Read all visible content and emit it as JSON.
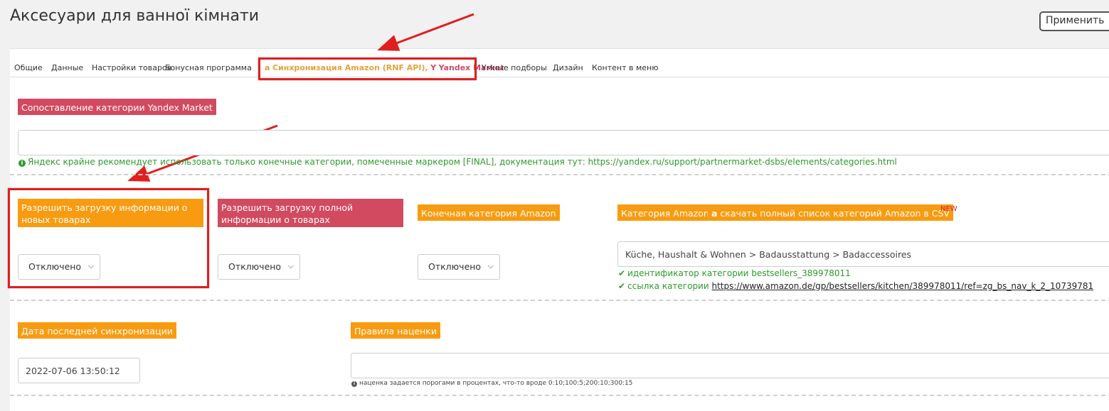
{
  "header": {
    "title": "Аксесуари для ванної кімнати",
    "apply_label": "Применить"
  },
  "tabs": [
    {
      "label": "Общие"
    },
    {
      "label": "Данные"
    },
    {
      "label": "Настройки товаров"
    },
    {
      "label": "Бонусная программа"
    },
    {
      "label_amazon": "Синхронизация Amazon (RNF API),",
      "label_yandex": "Yandex Market",
      "active": true
    },
    {
      "label": "Умные подборы"
    },
    {
      "label": "Дизайн"
    },
    {
      "label": "Контент в меню"
    }
  ],
  "yandex_section": {
    "label": "Сопоставление категории Yandex Market",
    "input_value": "",
    "help": "Яндекс крайне рекомендует использовать только конечные категории, помеченные маркером [FINAL], документация тут: https://yandex.ru/support/partnermarket-dsbs/elements/categories.html"
  },
  "amazon_section": {
    "new_items_label": "Разрешить загрузку информации о новых товарах",
    "new_items_value": "Отключено",
    "full_info_label": "Разрешить загрузку полной информации о товарах",
    "full_info_value": "Отключено",
    "final_category_label": "Конечная категория Amazon",
    "final_category_value": "Отключено",
    "category_label": "Категория Amazon",
    "download_label": "скачать полный список категорий Amazon в CSV",
    "new_badge": "NEW",
    "category_value": "Küche, Haushalt & Wohnen > Badausstattung > Badaccessoires",
    "category_id_label": "идентификатор категории",
    "category_id": "bestsellers_389978011",
    "category_link_label": "ссылка категории",
    "category_link": "https://www.amazon.de/gp/bestsellers/kitchen/389978011/ref=zg_bs_nav_k_2_10739781"
  },
  "sync_section": {
    "last_sync_label": "Дата последней синхронизации",
    "last_sync_value": "2022-07-06 13:50:12",
    "markup_label": "Правила наценки",
    "markup_value": "",
    "markup_help": "наценка задается порогами в процентах, что-то вроде 0:10;100:5;200:10;300:15"
  },
  "colors": {
    "orange_label": "#f89b10",
    "crimson_label": "#d14a5f",
    "highlight_box": "#e01f1f",
    "help_green": "#2e9b2e"
  }
}
